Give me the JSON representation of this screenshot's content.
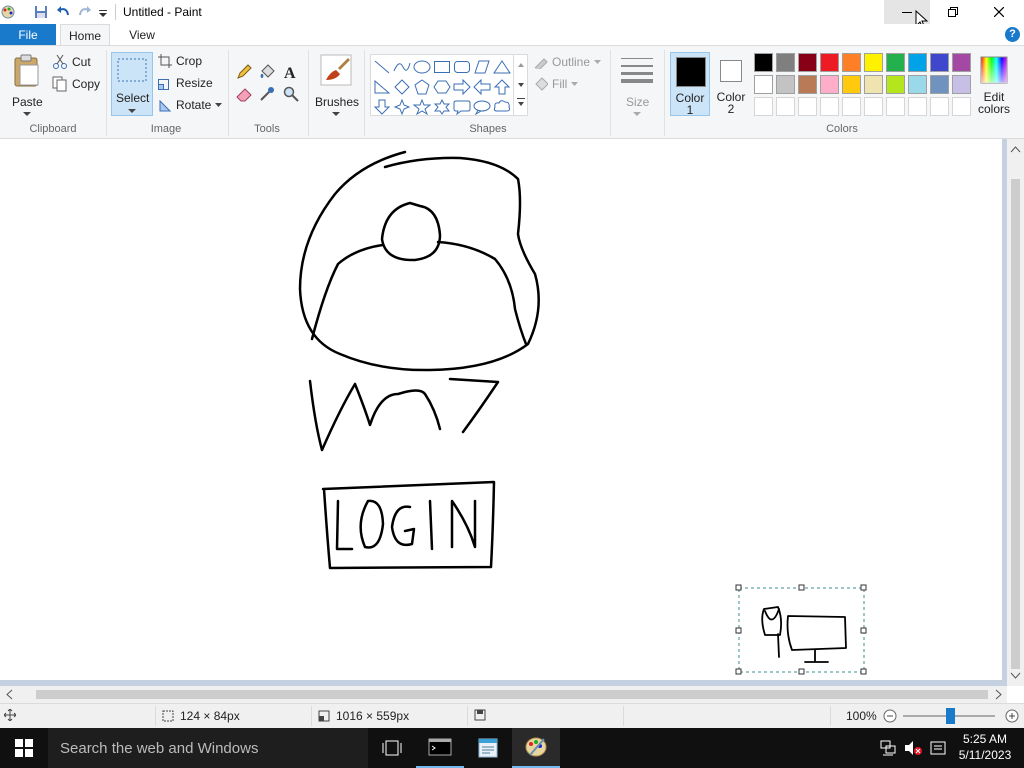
{
  "window": {
    "title": "Untitled - Paint"
  },
  "tabs": {
    "file": "File",
    "home": "Home",
    "view": "View"
  },
  "clipboard": {
    "paste": "Paste",
    "cut": "Cut",
    "copy": "Copy",
    "group": "Clipboard"
  },
  "image": {
    "select": "Select",
    "crop": "Crop",
    "resize": "Resize",
    "rotate": "Rotate",
    "group": "Image"
  },
  "tools": {
    "group": "Tools"
  },
  "brushes": {
    "label": "Brushes"
  },
  "shapes": {
    "outline": "Outline",
    "fill": "Fill",
    "group": "Shapes"
  },
  "size": {
    "label": "Size"
  },
  "colors": {
    "color1_label": "Color",
    "color1_num": "1",
    "color2_label": "Color",
    "color2_num": "2",
    "edit_label": "Edit",
    "edit_label2": "colors",
    "group": "Colors",
    "color1_value": "#000000",
    "color2_value": "#ffffff",
    "palette_row1": [
      "#000000",
      "#7f7f7f",
      "#880015",
      "#ed1c24",
      "#ff7f27",
      "#fff200",
      "#22b14c",
      "#00a2e8",
      "#3f48cc",
      "#a349a4"
    ],
    "palette_row2": [
      "#ffffff",
      "#c3c3c3",
      "#b97a57",
      "#ffaec9",
      "#ffc90e",
      "#efe4b0",
      "#b5e61d",
      "#99d9ea",
      "#7092be",
      "#c8bfe7"
    ]
  },
  "status": {
    "selection_size": "124 × 84px",
    "canvas_size": "1016 × 559px",
    "zoom": "100%"
  },
  "taskbar": {
    "search_placeholder": "Search the web and Windows",
    "time": "5:25 AM",
    "date": "5/11/2023"
  }
}
